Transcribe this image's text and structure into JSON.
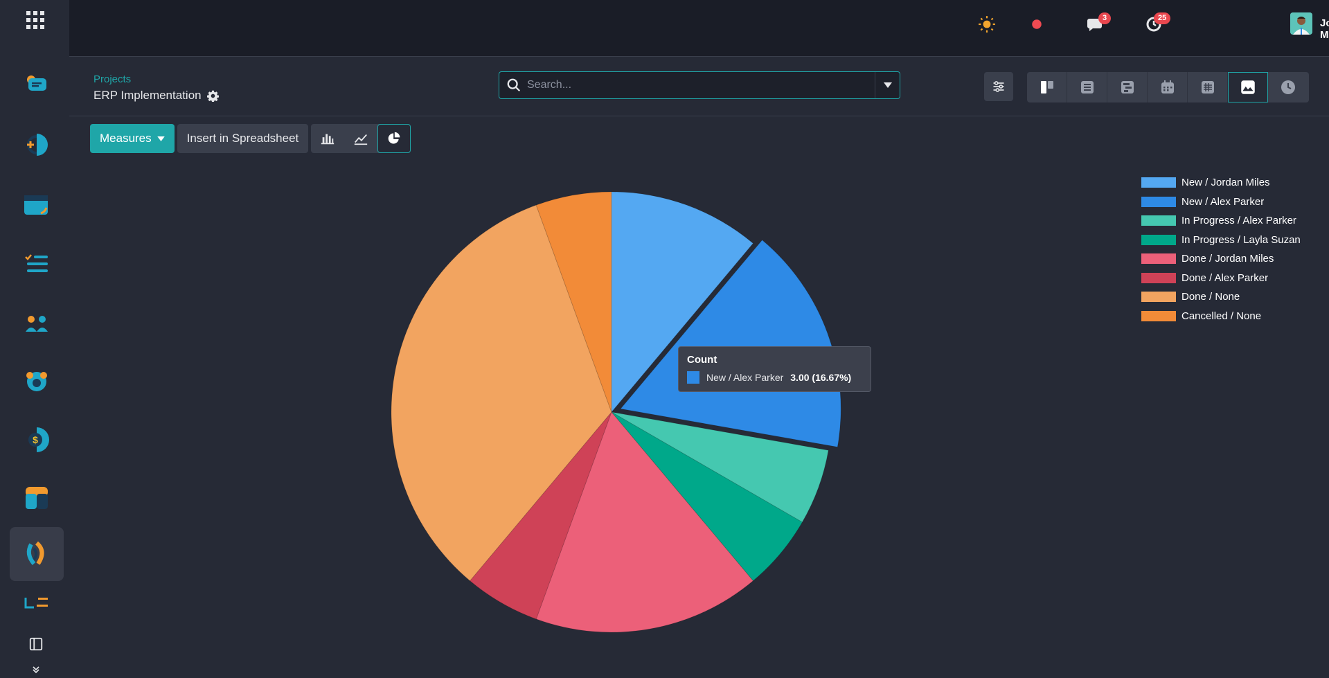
{
  "topbar": {
    "user_name": "Jordan Miles",
    "messages_count": "3",
    "activities_count": "25"
  },
  "breadcrumb": {
    "parent": "Projects",
    "current": "ERP Implementation"
  },
  "search": {
    "placeholder": "Search..."
  },
  "toolbar": {
    "measures_label": "Measures",
    "insert_label": "Insert in Spreadsheet"
  },
  "views": [
    "kanban",
    "list",
    "gantt",
    "calendar",
    "pivot",
    "graph",
    "activity"
  ],
  "chart_data": {
    "type": "pie",
    "measure": "Count",
    "slices": [
      {
        "label": "New / Jordan Miles",
        "value": 2,
        "color": "#54a8f2"
      },
      {
        "label": "New / Alex Parker",
        "value": 3,
        "color": "#2e8ae6"
      },
      {
        "label": "In Progress / Alex Parker",
        "value": 1,
        "color": "#45c8b0"
      },
      {
        "label": "In Progress / Layla Suzan",
        "value": 1,
        "color": "#00a88a"
      },
      {
        "label": "Done / Jordan Miles",
        "value": 3,
        "color": "#ec6079"
      },
      {
        "label": "Done / Alex Parker",
        "value": 1,
        "color": "#cf4257"
      },
      {
        "label": "Done / None",
        "value": 6,
        "color": "#f2a460"
      },
      {
        "label": "Cancelled / None",
        "value": 1,
        "color": "#f28b38"
      }
    ],
    "highlighted": 1,
    "legend_position": "top-right"
  },
  "tooltip": {
    "title": "Count",
    "label": "New / Alex Parker",
    "value": "3.00 (16.67%)"
  },
  "colors": {
    "accent": "#1fa6a8",
    "badge": "#e9474f",
    "background": "#262a36"
  }
}
